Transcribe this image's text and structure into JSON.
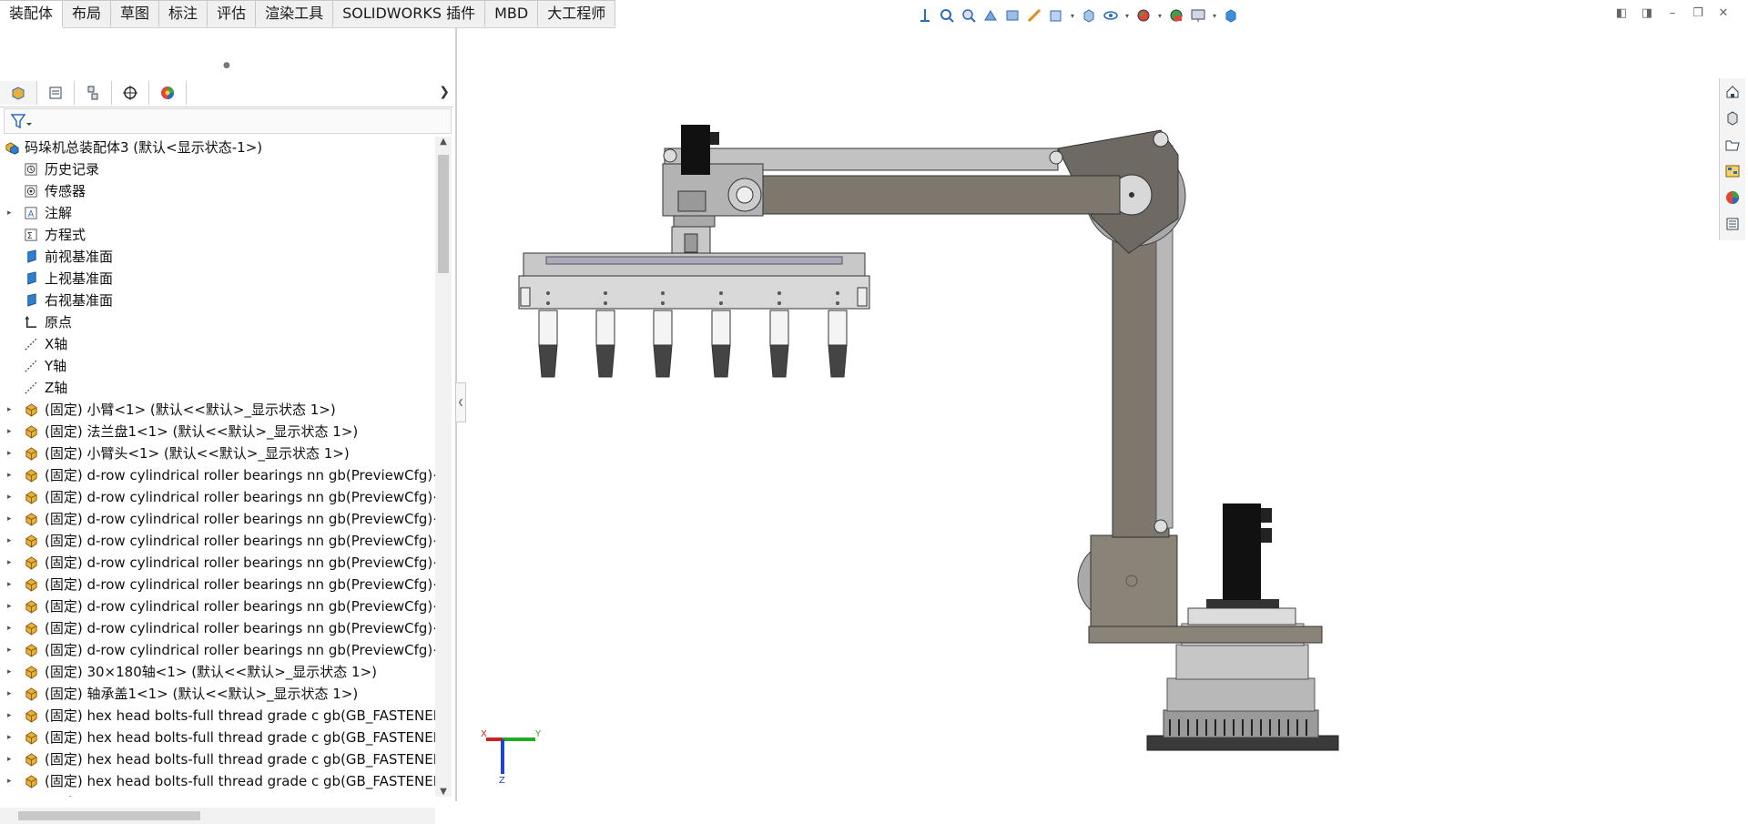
{
  "command_tabs": [
    "装配体",
    "布局",
    "草图",
    "标注",
    "评估",
    "渲染工具",
    "SOLIDWORKS 插件",
    "MBD",
    "大工程师"
  ],
  "active_tab": "装配体",
  "hud_icons": [
    "view-orientation-icon",
    "zoom-to-fit-icon",
    "zoom-area-icon",
    "previous-view-icon",
    "section-view-icon",
    "dynamic-annotation-icon",
    "view-orientation-dropdown-icon",
    "display-style-icon",
    "hide-show-items-icon",
    "edit-appearance-icon",
    "apply-scene-icon",
    "view-settings-icon",
    "3d-view-icon"
  ],
  "window_controls": [
    "tile-left-icon",
    "tile-right-icon",
    "minimize-icon",
    "restore-icon",
    "close-icon"
  ],
  "pane_tabs": [
    "featuremanager-tab",
    "propertymanager-tab",
    "configurationmanager-tab",
    "dimxpert-tab",
    "display-manager-tab"
  ],
  "tree": {
    "root": "码垛机总装配体3  (默认<显示状态-1>)",
    "items": [
      {
        "label": "历史记录",
        "icon": "history",
        "expand": false
      },
      {
        "label": "传感器",
        "icon": "sensor",
        "expand": false
      },
      {
        "label": "注解",
        "icon": "annotation",
        "expand": true
      },
      {
        "label": "方程式",
        "icon": "equation",
        "expand": false
      },
      {
        "label": "前视基准面",
        "icon": "plane",
        "expand": false
      },
      {
        "label": "上视基准面",
        "icon": "plane",
        "expand": false
      },
      {
        "label": "右视基准面",
        "icon": "plane",
        "expand": false
      },
      {
        "label": "原点",
        "icon": "origin",
        "expand": false
      },
      {
        "label": "X轴",
        "icon": "axis",
        "expand": false
      },
      {
        "label": "Y轴",
        "icon": "axis",
        "expand": false
      },
      {
        "label": "Z轴",
        "icon": "axis",
        "expand": false
      },
      {
        "label": "(固定) 小臂<1> (默认<<默认>_显示状态 1>)",
        "icon": "part",
        "expand": true
      },
      {
        "label": "(固定) 法兰盘1<1> (默认<<默认>_显示状态 1>)",
        "icon": "part",
        "expand": true
      },
      {
        "label": "(固定) 小臂头<1> (默认<<默认>_显示状态 1>)",
        "icon": "part",
        "expand": true
      },
      {
        "label": "(固定) d-row cylindrical roller bearings nn gb(PreviewCfg)<1",
        "icon": "part",
        "expand": true
      },
      {
        "label": "(固定) d-row cylindrical roller bearings nn gb(PreviewCfg)<2",
        "icon": "part",
        "expand": true
      },
      {
        "label": "(固定) d-row cylindrical roller bearings nn gb(PreviewCfg)<3",
        "icon": "part",
        "expand": true
      },
      {
        "label": "(固定) d-row cylindrical roller bearings nn gb(PreviewCfg)<4",
        "icon": "part",
        "expand": true
      },
      {
        "label": "(固定) d-row cylindrical roller bearings nn gb(PreviewCfg)<5",
        "icon": "part",
        "expand": true
      },
      {
        "label": "(固定) d-row cylindrical roller bearings nn gb(PreviewCfg)<6",
        "icon": "part",
        "expand": true
      },
      {
        "label": "(固定) d-row cylindrical roller bearings nn gb(PreviewCfg)<7",
        "icon": "part",
        "expand": true
      },
      {
        "label": "(固定) d-row cylindrical roller bearings nn gb(PreviewCfg)<8",
        "icon": "part",
        "expand": true
      },
      {
        "label": "(固定) d-row cylindrical roller bearings nn gb(PreviewCfg)<9",
        "icon": "part",
        "expand": true
      },
      {
        "label": "(固定) 30×180轴<1> (默认<<默认>_显示状态 1>)",
        "icon": "part",
        "expand": true
      },
      {
        "label": "(固定) 轴承盖1<1> (默认<<默认>_显示状态 1>)",
        "icon": "part",
        "expand": true
      },
      {
        "label": "(固定) hex head bolts-full thread grade c gb(GB_FASTENER_",
        "icon": "part",
        "expand": true
      },
      {
        "label": "(固定) hex head bolts-full thread grade c gb(GB_FASTENER_",
        "icon": "part",
        "expand": true
      },
      {
        "label": "(固定) hex head bolts-full thread grade c gb(GB_FASTENER_",
        "icon": "part",
        "expand": true
      },
      {
        "label": "(固定) hex head bolts-full thread grade c gb(GB_FASTENER_",
        "icon": "part",
        "expand": true
      },
      {
        "label": "(固定) hex head bolts-full thread grade c gb(GB_FASTENER_",
        "icon": "part",
        "expand": true
      }
    ]
  },
  "task_pane_icons": [
    "solidworks-resources-icon",
    "design-library-icon",
    "file-explorer-icon",
    "view-palette-icon",
    "appearances-icon",
    "custom-properties-icon"
  ],
  "triad": {
    "x": "X",
    "y": "Y",
    "z": "Z"
  },
  "colors": {
    "arm_gray": "#7d776e",
    "arm_light": "#b8b8b8",
    "tab_bg": "#f0f0f0",
    "part_icon": "#e8b23a"
  }
}
